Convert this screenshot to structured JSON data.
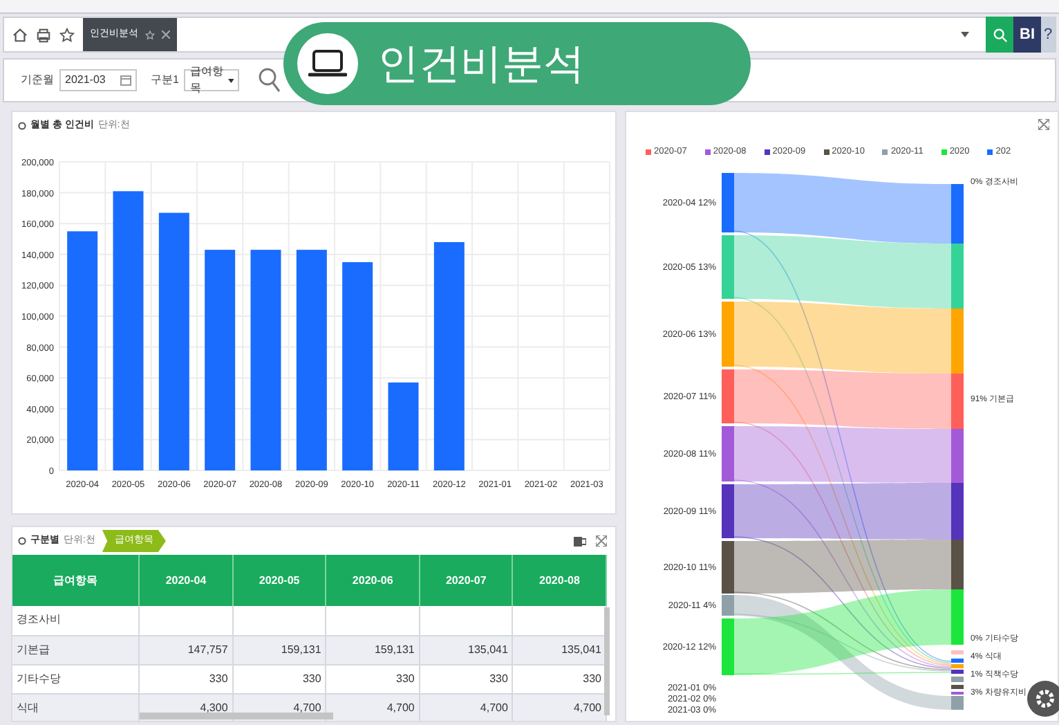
{
  "app_badge": {
    "title": "인건비분석"
  },
  "tab_bar": {
    "tabs": [
      {
        "label": "인건비분석",
        "selected": true
      }
    ],
    "buttons": [
      "BI",
      "?"
    ]
  },
  "filters": {
    "month_label": "기준월",
    "month_value": "2021-03",
    "group_label": "구분1",
    "group_value": "급여항목"
  },
  "monthly_chart": {
    "title": "월별 총 인건비",
    "unit": "단위:천",
    "chart_data": {
      "type": "bar",
      "categories": [
        "2020-04",
        "2020-05",
        "2020-06",
        "2020-07",
        "2020-08",
        "2020-09",
        "2020-10",
        "2020-11",
        "2020-12",
        "2021-01",
        "2021-02",
        "2021-03"
      ],
      "values": [
        155000,
        181000,
        167000,
        143000,
        143000,
        143000,
        135000,
        57000,
        148000,
        null,
        null,
        null
      ],
      "ylim": [
        0,
        200000
      ],
      "grid": true,
      "yticks": [
        {
          "value": 0,
          "label": "0"
        },
        {
          "value": 20000,
          "label": "20,000"
        },
        {
          "value": 40000,
          "label": "40,000"
        },
        {
          "value": 60000,
          "label": "60,000"
        },
        {
          "value": 80000,
          "label": "80,000"
        },
        {
          "value": 100000,
          "label": "100,000"
        },
        {
          "value": 120000,
          "label": "120,000"
        },
        {
          "value": 140000,
          "label": "140,000"
        },
        {
          "value": 160000,
          "label": "160,000"
        },
        {
          "value": 180000,
          "label": "180,000"
        },
        {
          "value": 200000,
          "label": "200,000"
        }
      ]
    }
  },
  "table_panel": {
    "title": "구분별",
    "unit": "단위:천",
    "breadcrumb": "급여항목",
    "columns": [
      "급여항목",
      "2020-04",
      "2020-05",
      "2020-06",
      "2020-07",
      "2020-08"
    ],
    "rows": [
      {
        "label": "경조사비"
      },
      {
        "label": "기본급",
        "values": [
          "147,757",
          "159,131",
          "159,131",
          "135,041",
          "135,041"
        ]
      },
      {
        "label": "기타수당",
        "values": [
          "330",
          "330",
          "330",
          "330",
          "330"
        ]
      },
      {
        "label": "식대",
        "values": [
          "4,300",
          "4,700",
          "4,700",
          "4,700",
          "4,700"
        ]
      }
    ]
  },
  "sankey": {
    "legend": [
      {
        "label": "2020-07",
        "color": "#ff5f5a"
      },
      {
        "label": "2020-08",
        "color": "#a35ad8"
      },
      {
        "label": "2020-09",
        "color": "#5533bb"
      },
      {
        "label": "2020-10",
        "color": "#5a5246"
      },
      {
        "label": "2020-11",
        "color": "#8fa0a8"
      },
      {
        "label": "2020",
        "color": "#1ce63c"
      },
      {
        "label": "202",
        "color": "#1a6cff"
      }
    ],
    "left_nodes": [
      {
        "label": "2020-04",
        "percent": "12%",
        "color": "#1a6cff"
      },
      {
        "label": "2020-05",
        "percent": "13%",
        "color": "#36d399"
      },
      {
        "label": "2020-06",
        "percent": "13%",
        "color": "#ffa500"
      },
      {
        "label": "2020-07",
        "percent": "11%",
        "color": "#ff5f5a"
      },
      {
        "label": "2020-08",
        "percent": "11%",
        "color": "#a35ad8"
      },
      {
        "label": "2020-09",
        "percent": "11%",
        "color": "#5533bb"
      },
      {
        "label": "2020-10",
        "percent": "11%",
        "color": "#5a5246"
      },
      {
        "label": "2020-11",
        "percent": "4%",
        "color": "#8fa0a8"
      },
      {
        "label": "2020-12",
        "percent": "12%",
        "color": "#1ce63c"
      },
      {
        "label": "2021-01",
        "percent": "0%"
      },
      {
        "label": "2021-02",
        "percent": "0%"
      },
      {
        "label": "2021-03",
        "percent": "0%"
      }
    ],
    "right_nodes": [
      {
        "percent": "0%",
        "label": "경조사비"
      },
      {
        "percent": "91%",
        "label": "기본급"
      },
      {
        "percent": "0%",
        "label": "기타수당"
      },
      {
        "percent": "4%",
        "label": "식대"
      },
      {
        "percent": "1%",
        "label": "직책수당"
      },
      {
        "percent": "3%",
        "label": "차량유지비"
      }
    ]
  }
}
